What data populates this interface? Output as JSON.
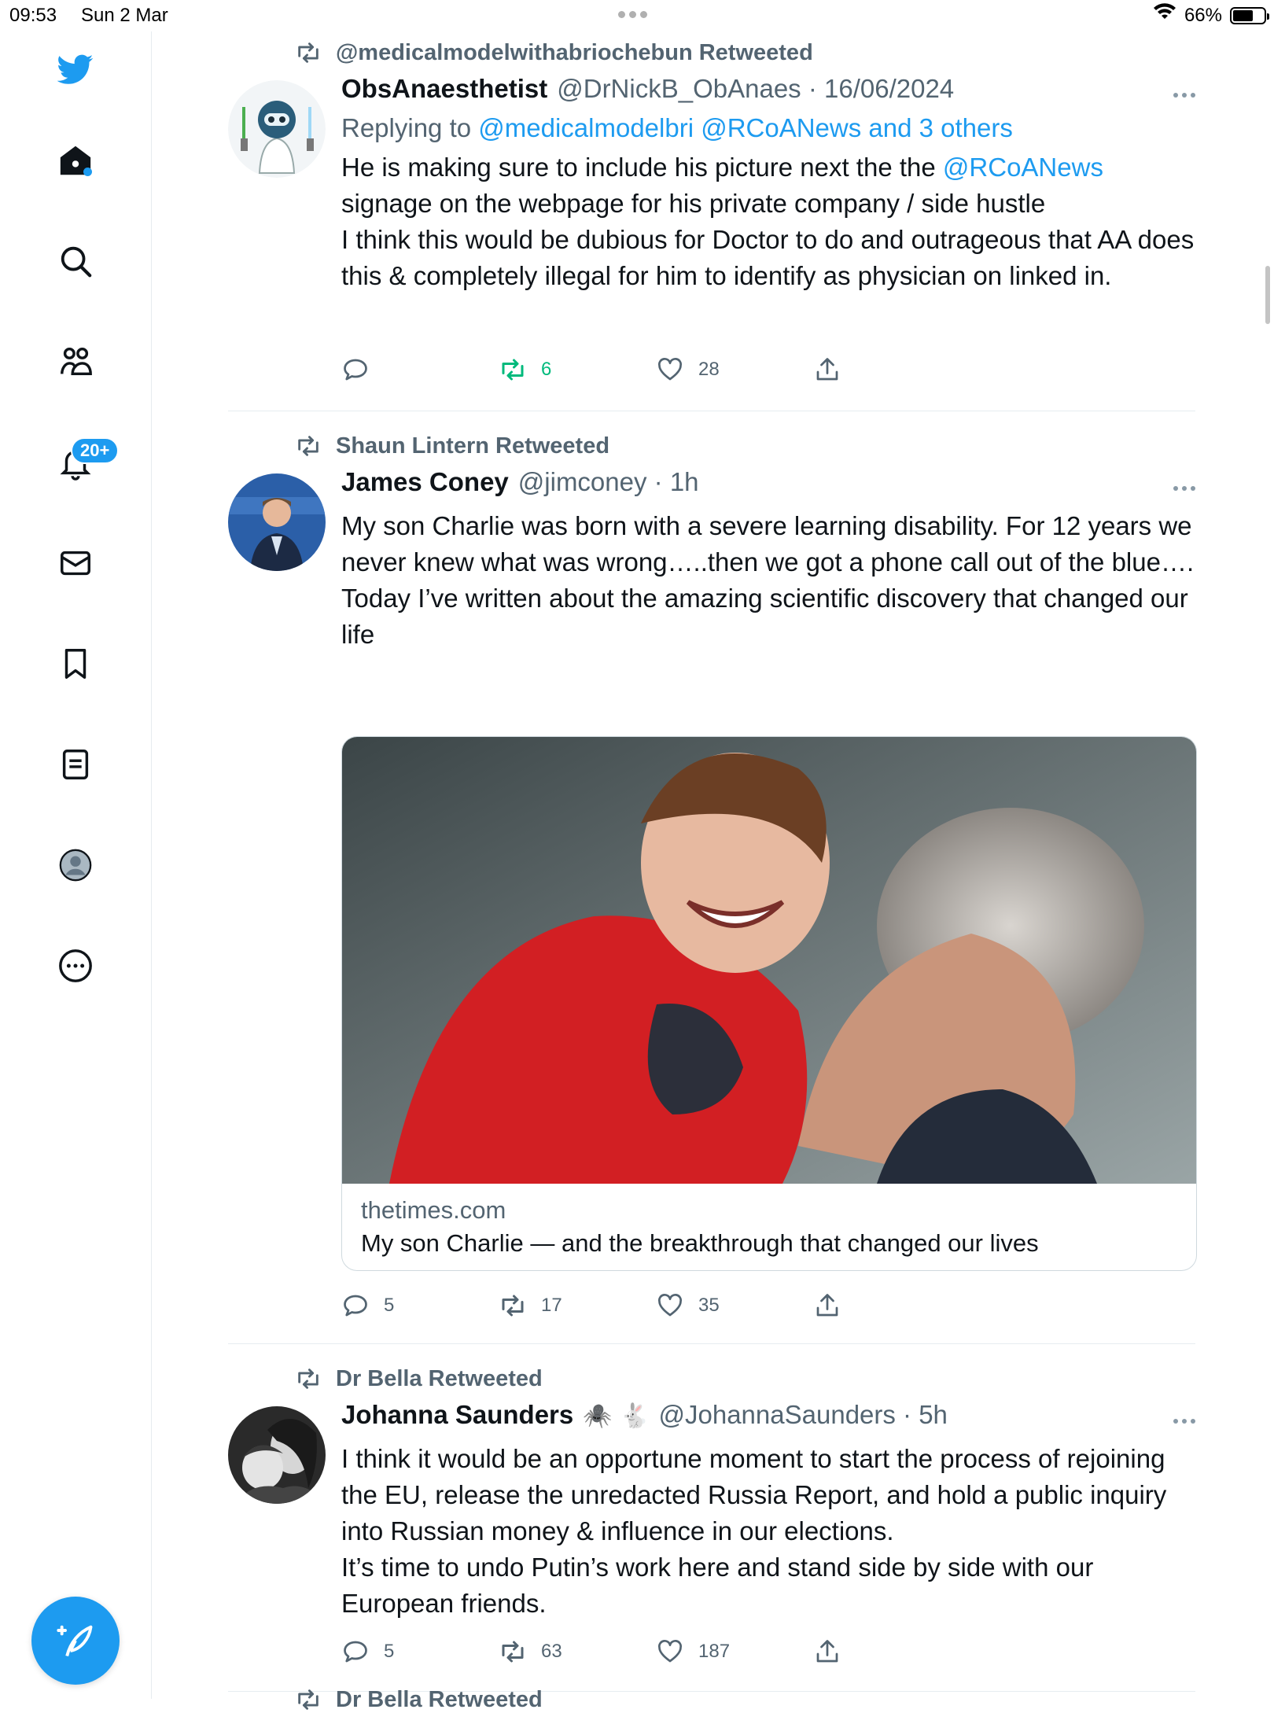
{
  "status_bar": {
    "time": "09:53",
    "date": "Sun 2 Mar",
    "battery": "66%",
    "battery_level": 0.66
  },
  "sidebar": {
    "notifications_badge": "20+"
  },
  "tweets": [
    {
      "retweeted_by": "@medicalmodelwithabriochebun Retweeted",
      "name": "ObsAnaesthetist",
      "handle": "@DrNickB_ObAnaes · 16/06/2024",
      "replying_prefix": "Replying to ",
      "replying_links": "@medicalmodelbri @RCoANews and 3 others",
      "text_before_link": "He is making sure to include his picture next the the ",
      "text_link": "@RCoANews",
      "text_after_link": " signage on the webpage for his private company / side hustle\nI think this would be dubious for Doctor to do and outrageous that AA does this & completely illegal for him to identify as physician on linked in.",
      "replies": "",
      "retweets": "6",
      "likes": "28"
    },
    {
      "retweeted_by": "Shaun Lintern Retweeted",
      "name": "James Coney",
      "handle": "@jimconey · 1h",
      "text": "My son Charlie was born with a severe learning disability. For 12 years we never knew what was wrong…..then we got a phone call out of the blue….\nToday I’ve written about the amazing scientific discovery that changed our life",
      "card_domain": "thetimes.com",
      "card_title": "My son Charlie — and the breakthrough that changed our lives",
      "replies": "5",
      "retweets": "17",
      "likes": "35"
    },
    {
      "retweeted_by": "Dr Bella Retweeted",
      "name": "Johanna Saunders",
      "name_emoji": "🕷️ 🐇",
      "handle": "@JohannaSaunders · 5h",
      "text": "I think it would be an opportune moment to start the process of rejoining the EU, release the unredacted Russia Report, and hold a public inquiry into Russian money & influence in our elections.\nIt’s time to undo Putin’s work here and stand side by side with our European friends.",
      "replies": "5",
      "retweets": "63",
      "likes": "187"
    },
    {
      "retweeted_by": "Dr Bella Retweeted"
    }
  ],
  "colors": {
    "accent": "#1d9bf0",
    "retweet_active": "#00ba7c",
    "muted": "#536471"
  }
}
